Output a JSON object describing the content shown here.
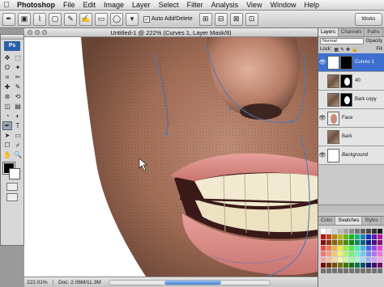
{
  "menubar": {
    "apple": "",
    "items": [
      "Photoshop",
      "File",
      "Edit",
      "Image",
      "Layer",
      "Select",
      "Filter",
      "Analysis",
      "View",
      "Window",
      "Help"
    ]
  },
  "options": {
    "auto_add_delete_label": "Auto Add/Delete",
    "auto_add_delete_checked": true,
    "workspace_label": "Works"
  },
  "document": {
    "title": "Untitled-1 @ 222% (Curves 1, Layer Mask/8)",
    "zoom": "222.01%",
    "doc_size": "Doc: 2.06M/11.3M"
  },
  "tools": {
    "logo": "Ps",
    "icons": [
      "move-icon",
      "marquee-icon",
      "lasso-icon",
      "magic-wand-icon",
      "crop-icon",
      "slice-icon",
      "healing-icon",
      "brush-icon",
      "stamp-icon",
      "history-brush-icon",
      "eraser-icon",
      "gradient-icon",
      "blur-icon",
      "dodge-icon",
      "pen-icon",
      "type-icon",
      "path-select-icon",
      "shape-icon",
      "notes-icon",
      "eyedropper-icon",
      "hand-icon",
      "zoom-icon"
    ],
    "glyphs": [
      "✥",
      "⬚",
      "ʘ",
      "✦",
      "⌗",
      "✂",
      "✚",
      "✎",
      "⊛",
      "⟲",
      "◫",
      "▤",
      "◔",
      "◐",
      "✒",
      "T",
      "➤",
      "▭",
      "☐",
      "⌿",
      "✋",
      "🔍"
    ],
    "active_index": 14
  },
  "panels": {
    "layers_tabs": [
      "Layers",
      "Channels",
      "Paths"
    ],
    "blend_mode": "Normal",
    "opacity_label": "Opacity",
    "lock_label": "Lock:",
    "fill_label": "Fill",
    "layers": [
      {
        "name": "Curves 1",
        "visible": true,
        "thumb": "curves",
        "mask": "black",
        "selected": true
      },
      {
        "name": "40",
        "visible": false,
        "thumb": "skin",
        "mask": "shape",
        "selected": false
      },
      {
        "name": "Bark copy",
        "visible": false,
        "thumb": "skin",
        "mask": "shape",
        "selected": false
      },
      {
        "name": "Face",
        "visible": true,
        "thumb": "face",
        "mask": "",
        "selected": false
      },
      {
        "name": "Bark",
        "visible": false,
        "thumb": "skin",
        "mask": "",
        "selected": false
      },
      {
        "name": "Background",
        "visible": true,
        "thumb": "white",
        "mask": "",
        "selected": false
      }
    ],
    "color_tabs": [
      "Color",
      "Swatches",
      "Styles"
    ]
  },
  "colors": {
    "skin_light": "#d9a792",
    "skin_mid": "#a56f58",
    "skin_dark": "#5e3d30",
    "lip": "#d98a86",
    "teeth": "#f2ead0",
    "path_stroke": "#4a7ab8",
    "selected_layer": "#3d6fd0"
  }
}
